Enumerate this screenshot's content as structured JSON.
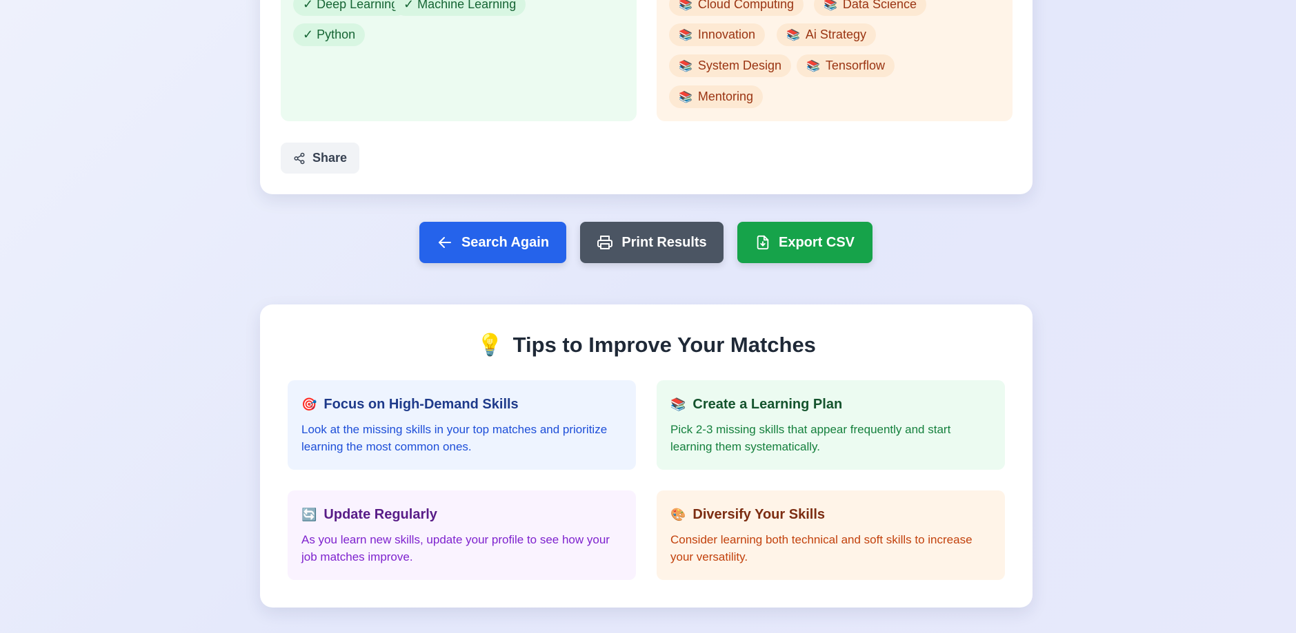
{
  "matched_skills": {
    "items": [
      "Deep Learning",
      "Machine Learning",
      "Python"
    ],
    "check_glyph": "✓"
  },
  "missing_skills": {
    "icon": "books-icon",
    "items": [
      "Cloud Computing",
      "Data Science",
      "Innovation",
      "Ai Strategy",
      "System Design",
      "Tensorflow",
      "Mentoring"
    ]
  },
  "share": {
    "label": "Share",
    "icon": "share-icon"
  },
  "actions": {
    "search_again": {
      "label": "Search Again",
      "icon": "arrow-left-icon",
      "color": "#2563eb"
    },
    "print_results": {
      "label": "Print Results",
      "icon": "printer-icon",
      "color": "#4b5563"
    },
    "export_csv": {
      "label": "Export CSV",
      "icon": "file-download-icon",
      "color": "#16a34a"
    }
  },
  "tips": {
    "title": "Tips to Improve Your Matches",
    "title_emoji": "💡",
    "items": [
      {
        "emoji": "🎯",
        "title": "Focus on High-Demand Skills",
        "text": "Look at the missing skills in your top matches and prioritize learning the most common ones."
      },
      {
        "emoji": "📚",
        "title": "Create a Learning Plan",
        "text": "Pick 2-3 missing skills that appear frequently and start learning them systematically."
      },
      {
        "emoji": "🔄",
        "title": "Update Regularly",
        "text": "As you learn new skills, update your profile to see how your job matches improve."
      },
      {
        "emoji": "🎨",
        "title": "Diversify Your Skills",
        "text": "Consider learning both technical and soft skills to increase your versatility."
      }
    ]
  }
}
